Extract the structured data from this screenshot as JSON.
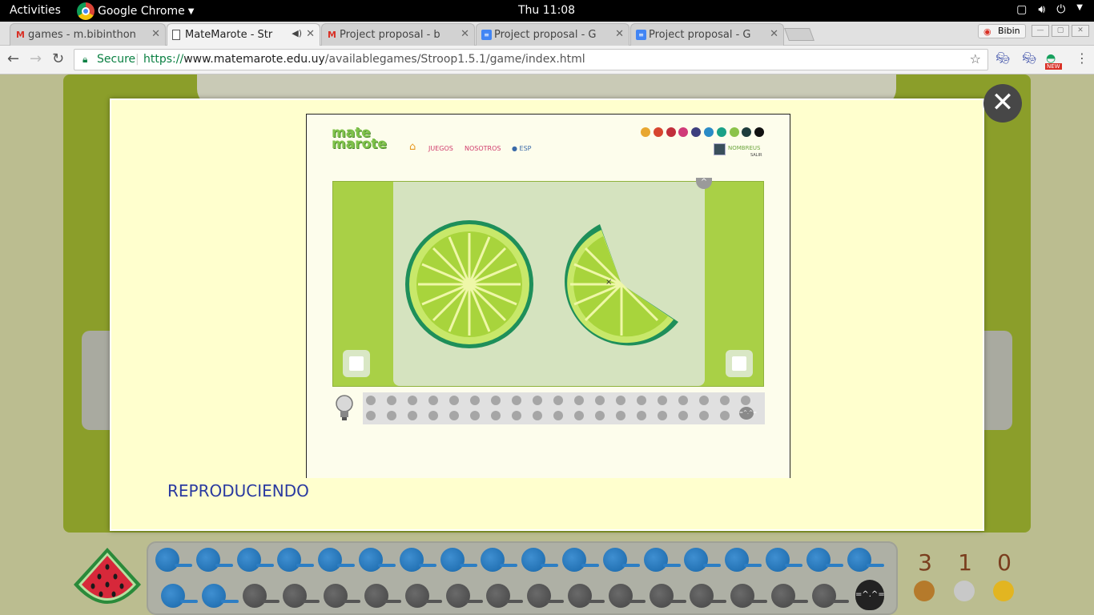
{
  "topbar": {
    "activities": "Activities",
    "app_menu": "Google Chrome",
    "clock": "Thu 11:08",
    "tray_icons": [
      "window-icon",
      "volume-icon",
      "power-icon"
    ]
  },
  "tabs": [
    {
      "title": "games - m.bibinthon",
      "icon": "gmail-icon",
      "active": false
    },
    {
      "title": "MateMarote - Str",
      "icon": "page-icon",
      "active": true,
      "audio": true
    },
    {
      "title": "Project proposal - b",
      "icon": "gmail-icon",
      "active": false
    },
    {
      "title": "Project proposal - G",
      "icon": "docs-icon",
      "active": false
    },
    {
      "title": "Project proposal - G",
      "icon": "docs-icon",
      "active": false
    }
  ],
  "profile": {
    "name": "Bibin"
  },
  "toolbar": {
    "secure_label": "Secure",
    "url_scheme": "https://",
    "url_host": "www.matemarote.edu.uy",
    "url_path": "/availablegames/Stroop1.5.1/game/index.html",
    "extensions": [
      "mask-icon",
      "mask-icon",
      "grammarly-icon"
    ],
    "new_badge": "NEW"
  },
  "modal": {
    "status_label": "REPRODUCIENDO",
    "close_glyph": "✕",
    "video": {
      "logo_line1": "mate",
      "logo_line2": "marote",
      "nav": [
        "JUEGOS",
        "NOSOTROS",
        "ESP"
      ],
      "user": "NOMBREUS",
      "logout": "SALIR",
      "palette": [
        "#e8a730",
        "#d7452f",
        "#c12f3b",
        "#d03a78",
        "#3d3f7e",
        "#2a8bc6",
        "#1aa187",
        "#8bc34a",
        "#1e3d3d",
        "#111111"
      ],
      "times_symbol": "×"
    }
  },
  "scores": [
    {
      "value": "3",
      "medal": "bronze",
      "color": "#b57a2b"
    },
    {
      "value": "1",
      "medal": "silver",
      "color": "#c8c8c8"
    },
    {
      "value": "0",
      "medal": "gold",
      "color": "#e2b521"
    }
  ],
  "progress": {
    "row1_completed": 18,
    "row1_total": 18,
    "row2_completed": 2,
    "row2_total": 17
  }
}
